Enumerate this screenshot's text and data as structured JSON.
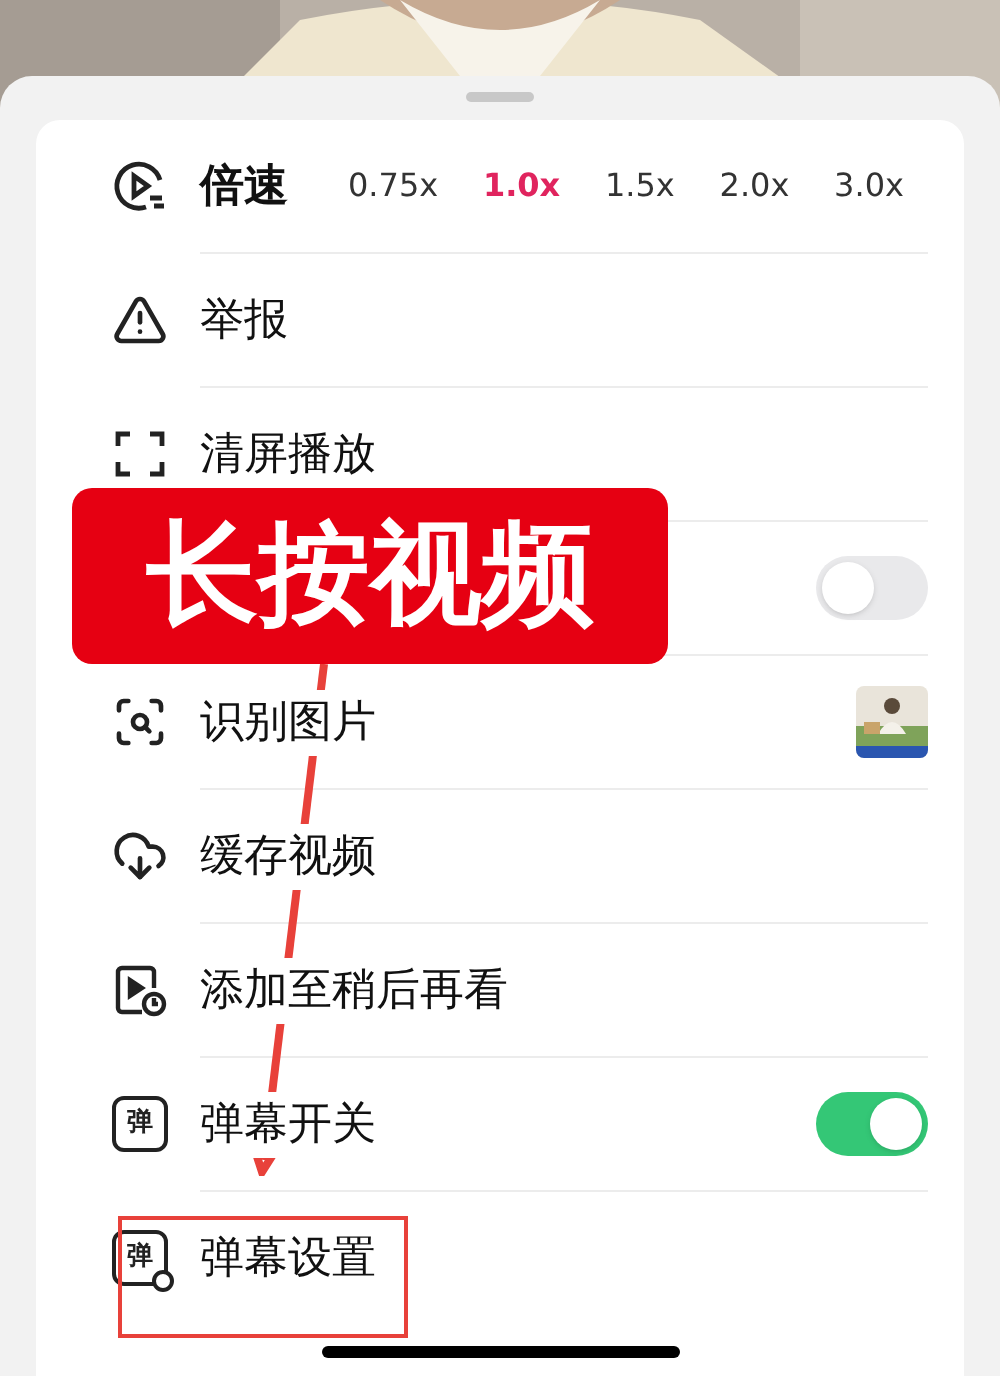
{
  "speed": {
    "label": "倍速",
    "options": [
      {
        "label": "0.75x",
        "selected": false
      },
      {
        "label": "1.0x",
        "selected": true
      },
      {
        "label": "1.5x",
        "selected": false
      },
      {
        "label": "2.0x",
        "selected": false
      },
      {
        "label": "3.0x",
        "selected": false
      }
    ]
  },
  "items": [
    {
      "kind": "plain",
      "label": "举报"
    },
    {
      "kind": "plain",
      "label": "清屏播放"
    },
    {
      "kind": "toggle",
      "on": false
    },
    {
      "kind": "thumbnail",
      "label": "识别图片"
    },
    {
      "kind": "plain",
      "label": "缓存视频"
    },
    {
      "kind": "plain",
      "label": "添加至稍后再看"
    },
    {
      "kind": "toggle",
      "icon_text": "弹",
      "label": "弹幕开关",
      "on": true
    },
    {
      "kind": "plain",
      "icon_text": "弹",
      "label": "弹幕设置"
    }
  ],
  "annotation": {
    "banner": "长按视频"
  }
}
